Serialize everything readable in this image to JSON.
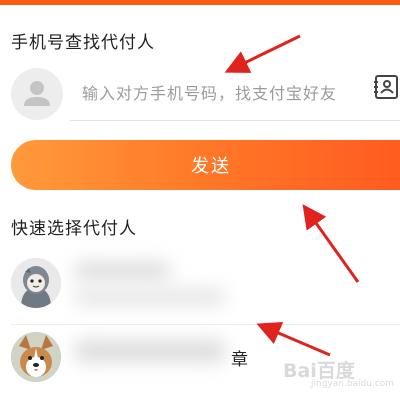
{
  "phone_section": {
    "title": "手机号查找代付人",
    "input_placeholder": "输入对方手机号码，找支付宝好友"
  },
  "send_button": {
    "label": "发送"
  },
  "quick_section": {
    "title": "快速选择代付人",
    "contacts": [
      {
        "name_visible": "",
        "avatar": "cartoon-penguin-avatar"
      },
      {
        "name_visible": "章",
        "avatar": "corgi-dog-avatar"
      }
    ]
  },
  "watermark": {
    "logo": "Bai百度",
    "subtitle": "jingyan.baidu.com"
  },
  "colors": {
    "accent": "#ff5a14",
    "button_start": "#ff9a3c",
    "button_end": "#ff5a1f",
    "arrow": "#e0231c"
  }
}
